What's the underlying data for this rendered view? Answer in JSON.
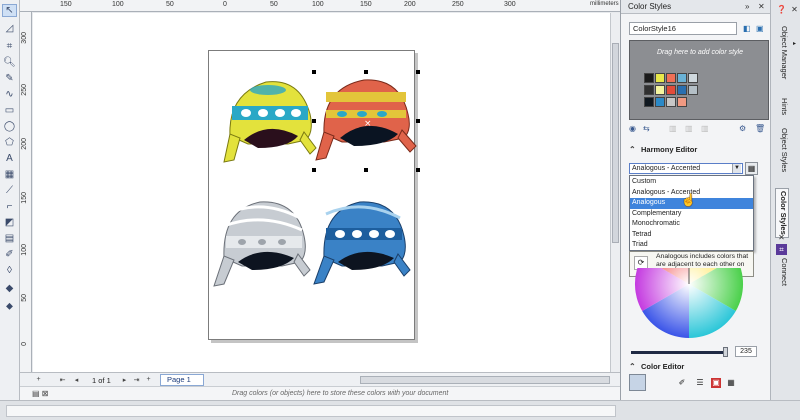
{
  "ruler": {
    "units": "millimeters",
    "top_ticks": [
      "150",
      "100",
      "50",
      "0",
      "50",
      "100",
      "150",
      "200",
      "250",
      "300"
    ],
    "left_ticks": [
      "300",
      "250",
      "200",
      "150",
      "100",
      "50",
      "0"
    ]
  },
  "page_nav": {
    "first": "⇤",
    "prev": "◂",
    "page_count": "1 of 1",
    "next": "▸",
    "last": "⇥",
    "add": "+",
    "page_tab": "Page 1"
  },
  "palette_hint": "Drag colors (or objects) here to store these colors with your document",
  "docker": {
    "title": "Color Styles",
    "style_name": "ColorStyle16",
    "drop_hint": "Drag here to add color style",
    "harmony_editor_label": "Harmony Editor",
    "harmony_selected": "Analogous - Accented",
    "harmony_options": [
      "Custom",
      "Analogous - Accented",
      "Analogous",
      "Complementary",
      "Monochromatic",
      "Tetrad",
      "Triad"
    ],
    "harmony_highlighted": "Analogous",
    "tooltip": "Analogous includes colors that are adjacent to each other on the color wheel.",
    "slider_value": "235",
    "color_editor_label": "Color Editor",
    "swatches_row1": [
      "#1b1b1b",
      "#e8e84a",
      "#f07056",
      "#6ab2d6",
      "#cfd8dd"
    ],
    "swatches_row2": [
      "#303030",
      "#f5f5a0",
      "#e24b3a",
      "#2a6fb0",
      "#b4bfc6"
    ],
    "swatches_row3": [
      "#101820",
      "#2b89c7",
      "#c7c7c7",
      "#f19a82"
    ]
  },
  "tabs": {
    "object_manager": "Object Manager",
    "hints": "Hints",
    "object_styles": "Object Styles",
    "color_styles": "Color Styles",
    "connect": "Connect"
  },
  "colors": {
    "accent": "#3f84dc",
    "hat_yellow": "#e3e23c",
    "hat_teal": "#2aa8c6",
    "hat_red": "#e0634a",
    "hat_grey": "#c7ccd2",
    "hat_blue": "#3a82c6"
  }
}
